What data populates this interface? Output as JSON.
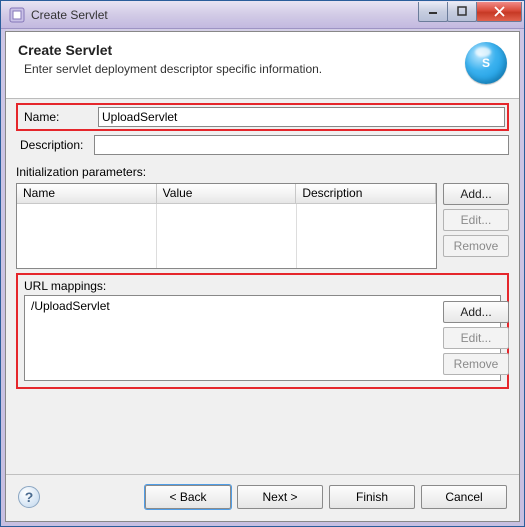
{
  "window": {
    "title": "Create Servlet"
  },
  "banner": {
    "heading": "Create Servlet",
    "subtitle": "Enter servlet deployment descriptor specific information.",
    "icon_letter": "S"
  },
  "form": {
    "name_label": "Name:",
    "name_value": "UploadServlet",
    "desc_label": "Description:",
    "desc_value": ""
  },
  "init_params": {
    "label": "Initialization parameters:",
    "columns": [
      "Name",
      "Value",
      "Description"
    ],
    "buttons": {
      "add": "Add...",
      "edit": "Edit...",
      "remove": "Remove"
    }
  },
  "url_mappings": {
    "label": "URL mappings:",
    "items": [
      "/UploadServlet"
    ],
    "buttons": {
      "add": "Add...",
      "edit": "Edit...",
      "remove": "Remove"
    }
  },
  "footer": {
    "back": "< Back",
    "next": "Next >",
    "finish": "Finish",
    "cancel": "Cancel"
  }
}
